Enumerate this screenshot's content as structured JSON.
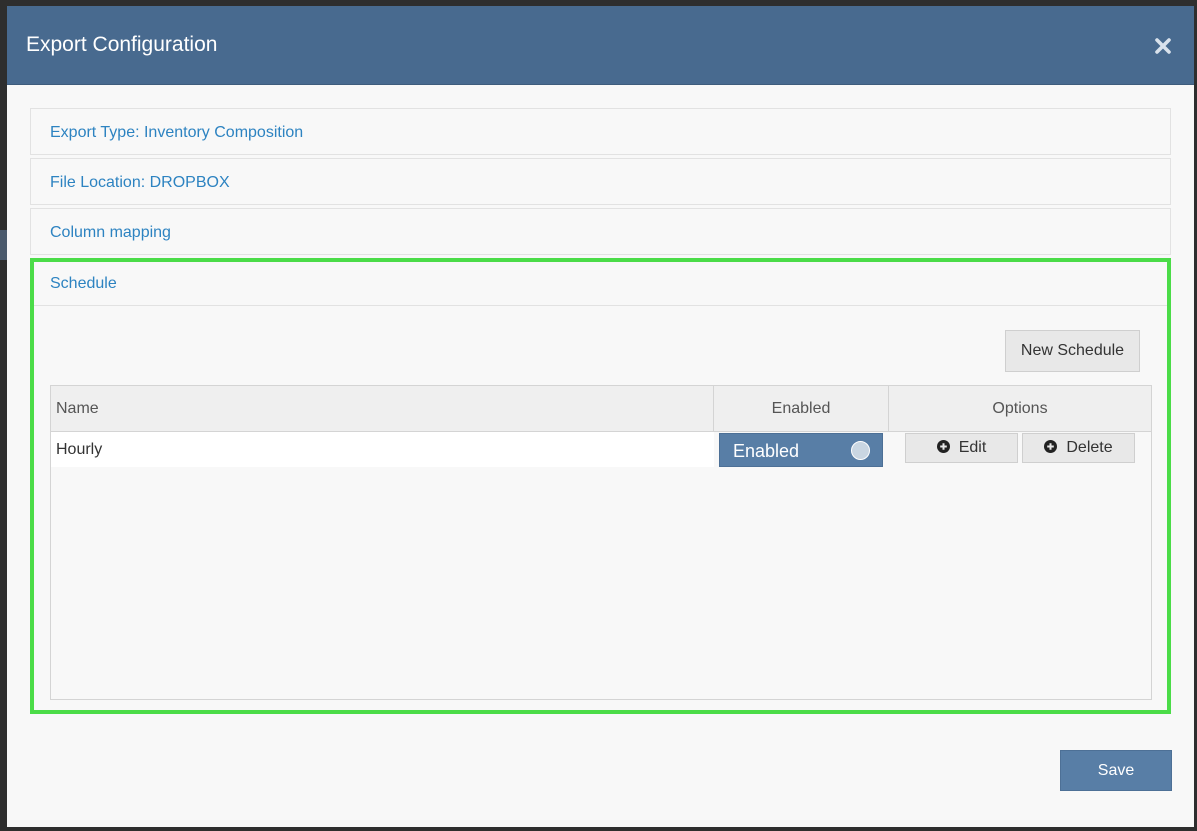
{
  "modal": {
    "title": "Export Configuration"
  },
  "sections": {
    "export_type": "Export Type: Inventory Composition",
    "file_location": "File Location: DROPBOX",
    "column_mapping": "Column mapping",
    "schedule": "Schedule"
  },
  "schedule": {
    "new_button": "New Schedule",
    "columns": {
      "name": "Name",
      "enabled": "Enabled",
      "options": "Options"
    },
    "rows": [
      {
        "name": "Hourly",
        "enabled_label": "Enabled",
        "edit_label": "Edit",
        "delete_label": "Delete"
      }
    ]
  },
  "footer": {
    "save_label": "Save"
  },
  "icons": {
    "close": "close-icon",
    "plus": "plus-circle-icon"
  },
  "colors": {
    "header_bg": "#486a8f",
    "link": "#2d83c1",
    "highlight_border": "#4bdc48",
    "primary_button": "#587ea6"
  }
}
